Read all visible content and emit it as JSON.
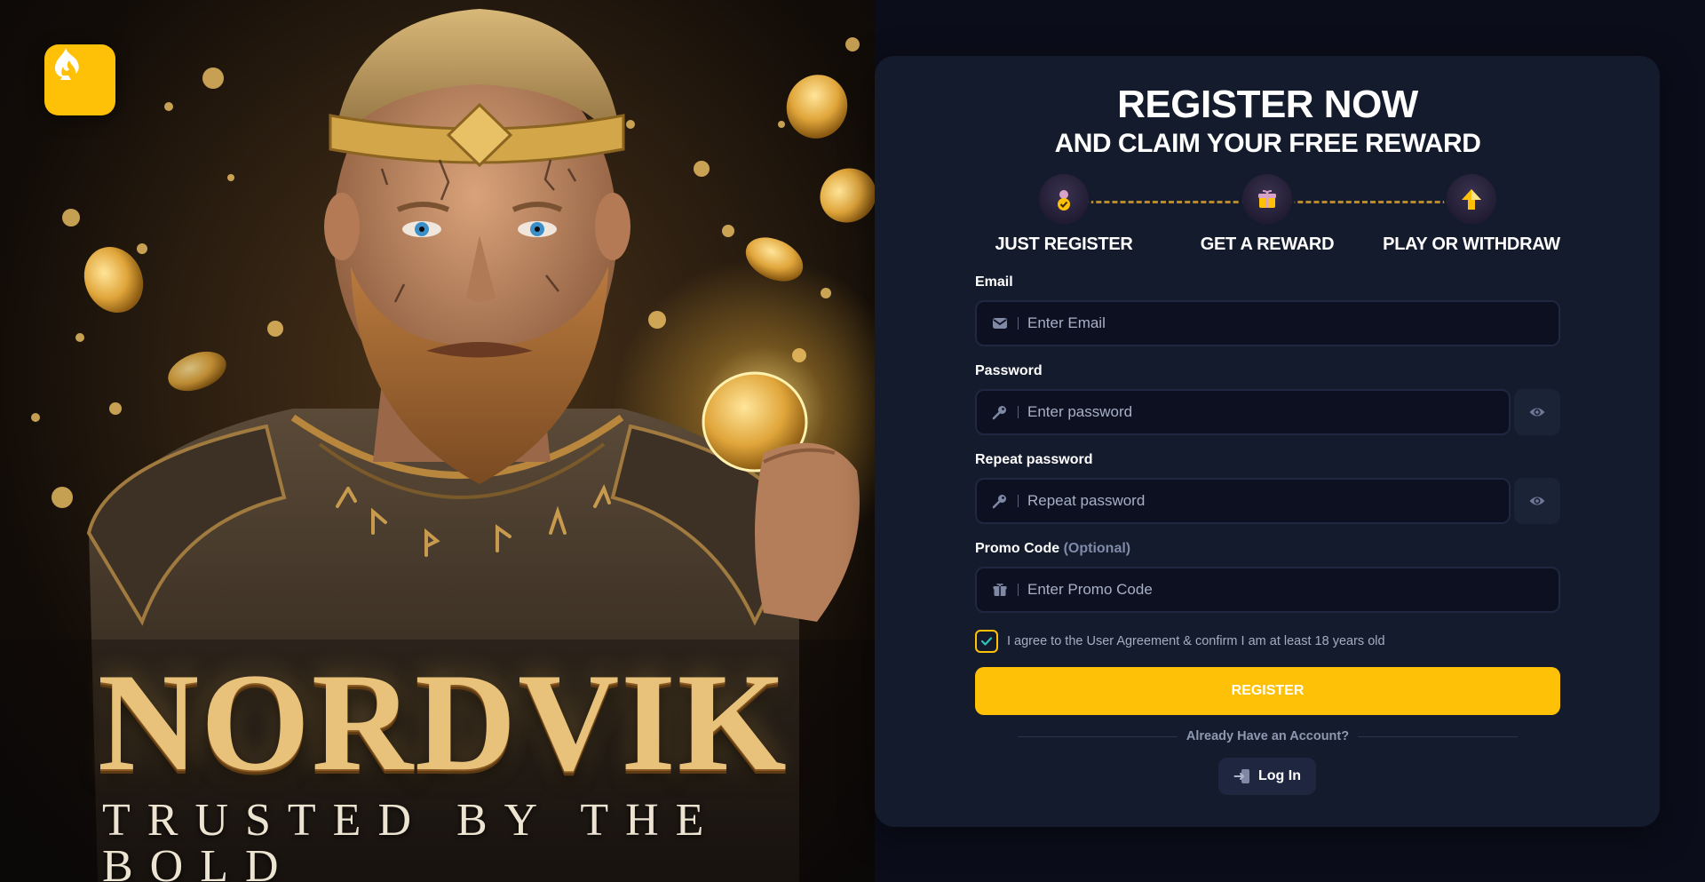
{
  "brand": {
    "logo_icon": "spade-flame-icon",
    "accent_color": "#ffc107",
    "hero_title": "NORDVIK",
    "hero_tagline": "TRUSTED BY THE BOLD"
  },
  "register": {
    "title": "REGISTER NOW",
    "subtitle": "AND CLAIM YOUR FREE REWARD",
    "steps": [
      {
        "label": "JUST REGISTER",
        "icon": "user-check-icon"
      },
      {
        "label": "GET A REWARD",
        "icon": "gift-icon"
      },
      {
        "label": "PLAY OR WITHDRAW",
        "icon": "arrow-up-icon"
      }
    ],
    "email": {
      "label": "Email",
      "placeholder": "Enter Email",
      "icon": "envelope-icon"
    },
    "password": {
      "label": "Password",
      "placeholder": "Enter password",
      "icon": "key-icon",
      "toggle_icon": "eye-icon"
    },
    "repeat_password": {
      "label": "Repeat password",
      "placeholder": "Repeat password",
      "icon": "key-icon",
      "toggle_icon": "eye-icon"
    },
    "promo": {
      "label": "Promo Code",
      "optional": "(Optional)",
      "placeholder": "Enter Promo Code",
      "icon": "gift-icon"
    },
    "agreement": {
      "text": "I agree to the User Agreement & confirm I am at least 18 years old",
      "checked": true
    },
    "register_button": "REGISTER",
    "already_text": "Already Have an Account?",
    "login_button": "Log In"
  }
}
